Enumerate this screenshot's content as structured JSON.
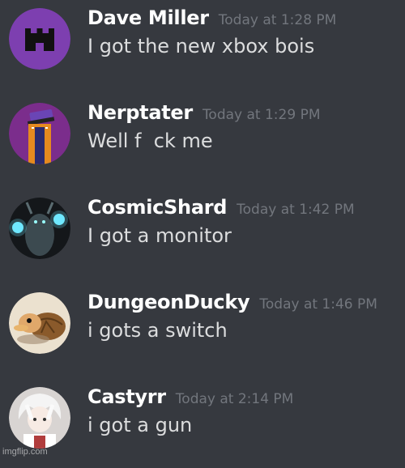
{
  "messages": [
    {
      "username": "Dave Miller",
      "timestamp": "Today at 1:28 PM",
      "text": "I got the new xbox bois",
      "avatar": "purple-castle-avatar"
    },
    {
      "username": "Nerptater",
      "timestamp": "Today at 1:29 PM",
      "text": "Well f  ck me",
      "avatar": "purple-character-avatar"
    },
    {
      "username": "CosmicShard",
      "timestamp": "Today at 1:42 PM",
      "text": "I got a monitor",
      "avatar": "glowing-eyes-creature-avatar"
    },
    {
      "username": "DungeonDucky",
      "timestamp": "Today at 1:46 PM",
      "text": "i gots a switch",
      "avatar": "duck-turtle-avatar"
    },
    {
      "username": "Castyrr",
      "timestamp": "Today at 2:14 PM",
      "text": "i got a gun",
      "avatar": "white-hair-character-avatar"
    }
  ],
  "watermark": "imgflip.com",
  "colors": {
    "background": "#36393f",
    "username": "#ffffff",
    "timestamp": "#72767d",
    "message_text": "#dcddde"
  }
}
